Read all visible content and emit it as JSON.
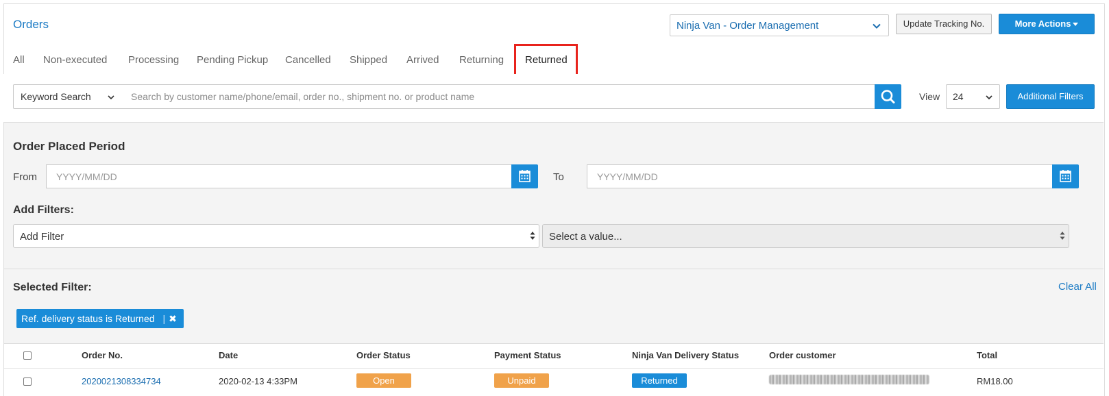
{
  "header": {
    "title": "Orders",
    "store_select": "Ninja Van - Order Management",
    "update_tracking_label": "Update Tracking No.",
    "more_actions_label": "More Actions"
  },
  "tabs": [
    {
      "label": "All"
    },
    {
      "label": "Non-executed"
    },
    {
      "label": "Processing"
    },
    {
      "label": "Pending Pickup"
    },
    {
      "label": "Cancelled"
    },
    {
      "label": "Shipped"
    },
    {
      "label": "Arrived"
    },
    {
      "label": "Returning"
    },
    {
      "label": "Returned",
      "active": true
    }
  ],
  "search": {
    "type_select": "Keyword Search",
    "placeholder": "Search by customer name/phone/email, order no., shipment no. or product name",
    "view_label": "View",
    "view_value": "24",
    "additional_filters_label": "Additional Filters"
  },
  "filters": {
    "period_label": "Order Placed Period",
    "from_label": "From",
    "to_label": "To",
    "from_placeholder": "YYYY/MM/DD",
    "to_placeholder": "YYYY/MM/DD",
    "add_filters_label": "Add Filters:",
    "add_filter_select": "Add Filter",
    "value_select": "Select a value..."
  },
  "selected_filter": {
    "label": "Selected Filter:",
    "clear_all_label": "Clear All",
    "chip_label": "Ref. delivery status is Returned",
    "chip_sep": "|",
    "chip_remove": "✖"
  },
  "table": {
    "headers": [
      "Order No.",
      "Date",
      "Order Status",
      "Payment Status",
      "Ninja Van Delivery Status",
      "Order customer",
      "Total"
    ],
    "rows": [
      {
        "order_no": "2020021308334734",
        "date": "2020-02-13 4:33PM",
        "order_status": "Open",
        "payment_status": "Unpaid",
        "delivery_status": "Returned",
        "total": "RM18.00"
      }
    ]
  },
  "colors": {
    "primary": "#1a8cd8",
    "link": "#1a7ac4",
    "highlight": "#e8231c",
    "orange": "#f0a24a",
    "panel_bg": "#f4f4f4"
  },
  "icons": [
    "chevron-down-icon",
    "search-icon",
    "calendar-icon",
    "close-icon",
    "updown-icon",
    "caret-down-icon"
  ]
}
